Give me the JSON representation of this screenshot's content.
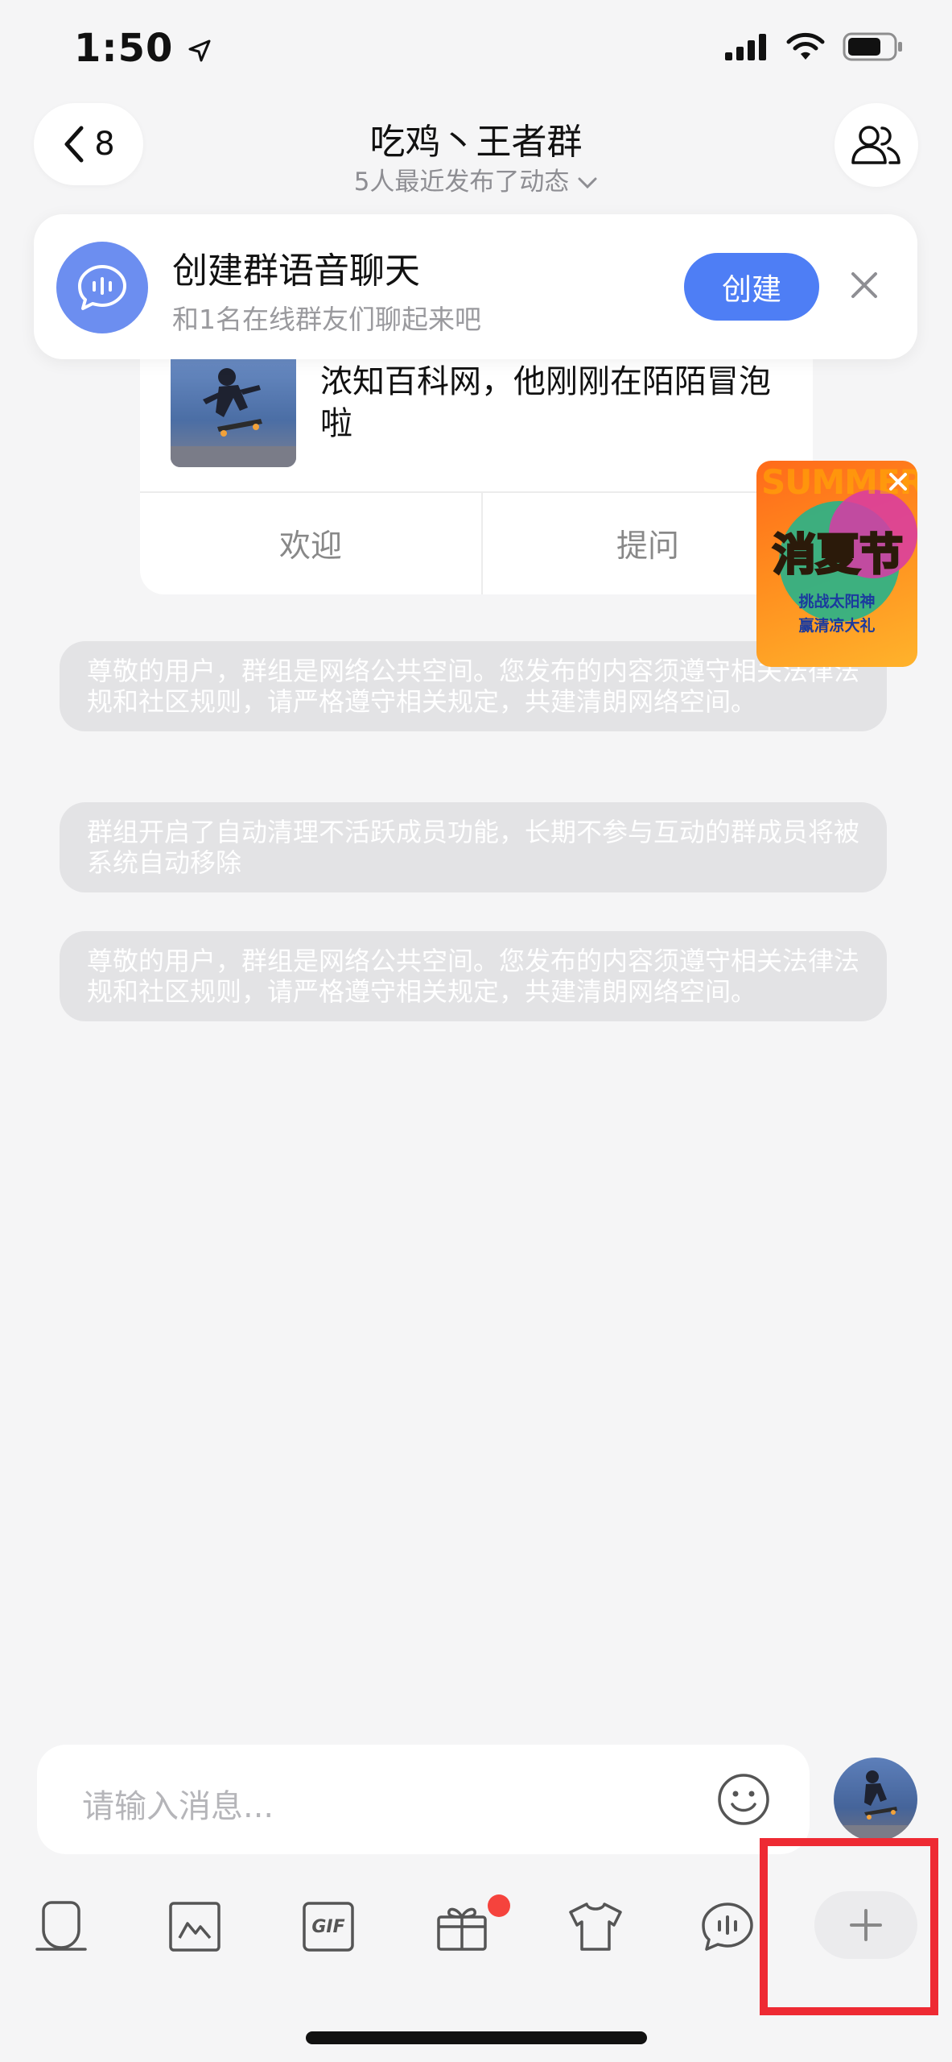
{
  "status_bar": {
    "time": "1:50"
  },
  "header": {
    "back_count": "8",
    "title": "吃鸡丶王者群",
    "subtitle": "5人最近发布了动态"
  },
  "voice_banner": {
    "title": "创建群语音聊天",
    "description": "和1名在线群友们聊起来吧",
    "create_label": "创建"
  },
  "welcome_card": {
    "text": "浓知百科网，他刚刚在陌陌冒泡啦",
    "actions": [
      "欢迎",
      "提问"
    ]
  },
  "promo": {
    "word": "SUMMER",
    "title": "消夏节",
    "lines": [
      "挑战太阳神",
      "赢清凉大礼"
    ]
  },
  "notices": [
    "尊敬的用户，群组是网络公共空间。您发布的内容须遵守相关法律法规和社区规则，请严格遵守相关规定，共建清朗网络空间。",
    "群组开启了自动清理不活跃成员功能，长期不参与互动的群成员将被系统自动移除",
    "尊敬的用户，群组是网络公共空间。您发布的内容须遵守相关法律法规和社区规则，请严格遵守相关规定，共建清朗网络空间。"
  ],
  "input": {
    "placeholder": "请输入消息..."
  },
  "toolbar": {
    "icons": [
      "voice-icon",
      "image-icon",
      "gif-icon",
      "gift-icon",
      "outfit-icon",
      "voice-chat-icon",
      "plus-icon"
    ],
    "gif_label": "GIF"
  },
  "colors": {
    "accent": "#4e7ef5",
    "badge_dot": "#f5433d",
    "highlight": "#ee2a33"
  }
}
